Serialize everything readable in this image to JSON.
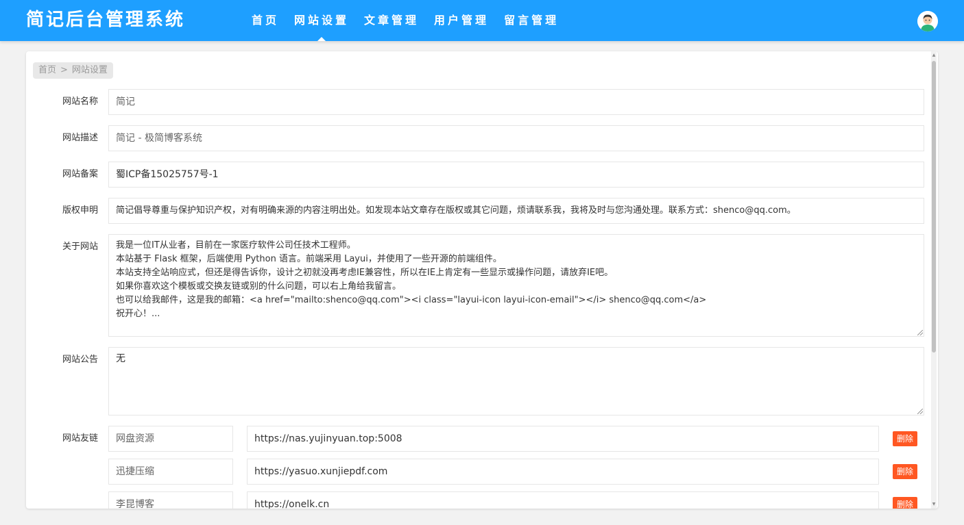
{
  "header": {
    "logo": "简记后台管理系统",
    "nav": [
      {
        "label": "首页",
        "active": false
      },
      {
        "label": "网站设置",
        "active": true
      },
      {
        "label": "文章管理",
        "active": false
      },
      {
        "label": "用户管理",
        "active": false
      },
      {
        "label": "留言管理",
        "active": false
      }
    ],
    "avatar_icon": "user-avatar-icon"
  },
  "breadcrumb": {
    "home": "首页",
    "separator": ">",
    "current": "网站设置"
  },
  "form": {
    "site_name": {
      "label": "网站名称",
      "value": "简记"
    },
    "site_desc": {
      "label": "网站描述",
      "value": "简记 - 极简博客系统"
    },
    "site_icp": {
      "label": "网站备案",
      "value": "蜀ICP备15025757号-1"
    },
    "copyright": {
      "label": "版权申明",
      "value": "简记倡导尊重与保护知识产权，对有明确来源的内容注明出处。如发现本站文章存在版权或其它问题，烦请联系我，我将及时与您沟通处理。联系方式：shenco@qq.com。"
    },
    "about": {
      "label": "关于网站",
      "lines": [
        "我是一位IT从业者，目前在一家医疗软件公司任技术工程师。",
        "本站基于 Flask 框架，后端使用 Python 语言。前端采用 Layui，并使用了一些开源的前端组件。",
        "本站支持全站响应式，但还是得告诉你，设计之初就没再考虑IE兼容性，所以在IE上肯定有一些显示或操作问题，请放弃IE吧。",
        "如果你喜欢这个模板或交换友链或别的什么问题，可以右上角给我留言。",
        "也可以给我邮件，这是我的邮箱：<a href=\"mailto:shenco@qq.com\"><i class=\"layui-icon layui-icon-email\"></i> shenco@qq.com</a>",
        "祝开心！..."
      ]
    },
    "notice": {
      "label": "网站公告",
      "value": "无"
    },
    "links": {
      "label": "网站友链",
      "delete_label": "删除",
      "items": [
        {
          "name": "网盘资源",
          "url": "https://nas.yujinyuan.top:5008"
        },
        {
          "name": "迅捷压缩",
          "url": "https://yasuo.xunjiepdf.com"
        },
        {
          "name": "李昆博客",
          "url": "https://onelk.cn"
        }
      ]
    }
  },
  "colors": {
    "header": "#1e9fff",
    "danger": "#ff5722",
    "background": "#f2f2f2"
  }
}
